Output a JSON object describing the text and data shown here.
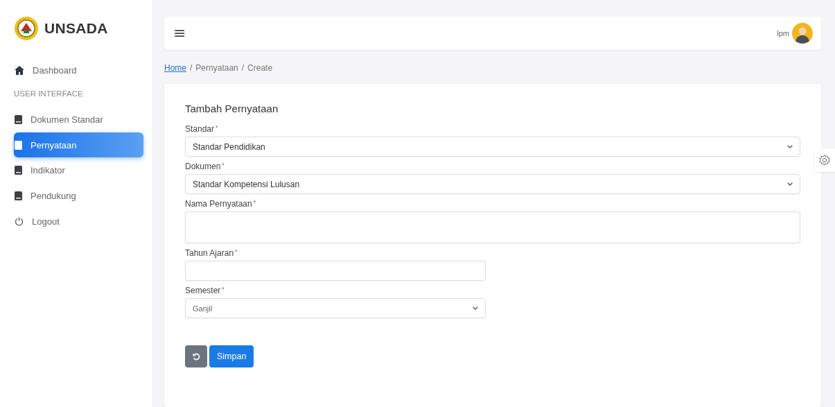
{
  "sidebar": {
    "brand": "UNSADA",
    "items": [
      {
        "kind": "home",
        "label": "Dashboard",
        "selected": false
      },
      {
        "kind": "heading",
        "label": "USER INTERFACE"
      },
      {
        "kind": "page",
        "label": "Dokumen Standar",
        "selected": false
      },
      {
        "kind": "page",
        "label": "Pernyataan",
        "selected": true
      },
      {
        "kind": "page",
        "label": "Indikator",
        "selected": false
      },
      {
        "kind": "page",
        "label": "Pendukung",
        "selected": false
      },
      {
        "kind": "logout",
        "label": "Logout",
        "selected": false
      }
    ]
  },
  "topbar": {
    "menu_icon": "≡",
    "user": "lpm"
  },
  "breadcrumb": [
    {
      "label": "Home",
      "link": true
    },
    {
      "label": "Pernyataan",
      "link": false
    },
    {
      "label": "Create",
      "link": false
    }
  ],
  "breadcrumb_separator": "/",
  "form": {
    "title": "Tambah Pernyataan",
    "fields": [
      {
        "kind": "select",
        "label": "Standar",
        "mark": "*",
        "value": "Standar Pendidikan"
      },
      {
        "kind": "select",
        "label": "Dokumen",
        "mark": "*",
        "value": "Standar Kompetensi Lulusan"
      },
      {
        "kind": "textarea",
        "label": "Nama Pernyataan",
        "mark": "*"
      },
      {
        "kind": "short_input",
        "label": "Tahun Ajaran",
        "mark": "*"
      },
      {
        "kind": "short_select",
        "label": "Semester",
        "mark": "*",
        "value": "Ganjil"
      }
    ],
    "buttons": [
      {
        "kind": "reset"
      },
      {
        "kind": "submit",
        "label": "Simpan"
      }
    ]
  }
}
